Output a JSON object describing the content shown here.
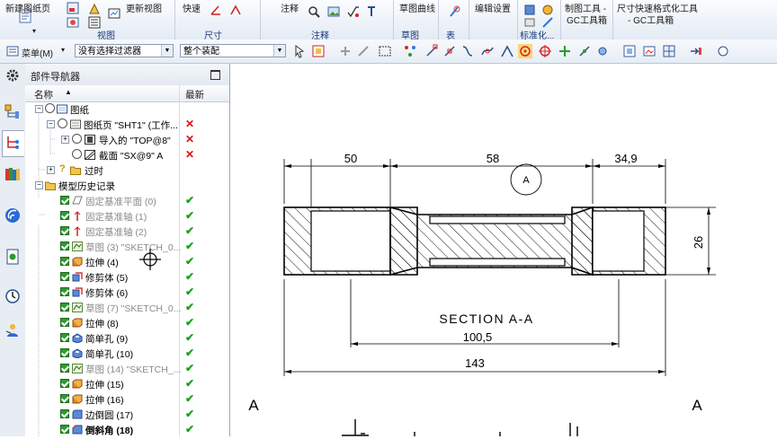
{
  "ribbon": {
    "new_sheet": "新建图纸页",
    "update_view": "更新视图",
    "view_group": "视图",
    "quick": "快速",
    "dimension_group": "尺寸",
    "annotation": "注释",
    "annotation_group": "注释",
    "sketch_curve": "草图曲线",
    "sketch_group": "草图",
    "table_group": "表",
    "edit_settings": "编辑设置",
    "standardize": "标准化...",
    "drafting_tool": "制图工具 -",
    "drafting_tool2": "GC工具箱",
    "dim_format": "尺寸快速格式化工具",
    "dim_format2": "- GC工具箱"
  },
  "toolbar": {
    "menu_label": "菜单(M)",
    "filter_value": "没有选择过滤器",
    "assembly_value": "整个装配"
  },
  "navigator": {
    "title": "部件导航器",
    "col_name": "名称",
    "col_latest": "最新",
    "rows": [
      {
        "label": "图纸",
        "status": ""
      },
      {
        "label": "图纸页 \"SHT1\" (工作...",
        "status": "✕"
      },
      {
        "label": "导入的 \"TOP@8\"",
        "status": "✕"
      },
      {
        "label": "截面 \"SX@9\" A",
        "status": "✕"
      },
      {
        "label": "过时",
        "status": ""
      },
      {
        "label": "模型历史记录",
        "status": ""
      },
      {
        "label": "固定基准平面 (0)",
        "status": "✔"
      },
      {
        "label": "固定基准轴 (1)",
        "status": "✔"
      },
      {
        "label": "固定基准轴 (2)",
        "status": "✔"
      },
      {
        "label": "草图 (3) \"SKETCH_0...",
        "status": "✔"
      },
      {
        "label": "拉伸 (4)",
        "status": "✔"
      },
      {
        "label": "修剪体 (5)",
        "status": "✔"
      },
      {
        "label": "修剪体 (6)",
        "status": "✔"
      },
      {
        "label": "草图 (7) \"SKETCH_0...",
        "status": "✔"
      },
      {
        "label": "拉伸 (8)",
        "status": "✔"
      },
      {
        "label": "简单孔 (9)",
        "status": "✔"
      },
      {
        "label": "简单孔 (10)",
        "status": "✔"
      },
      {
        "label": "草图 (14) \"SKETCH_...",
        "status": "✔"
      },
      {
        "label": "拉伸 (15)",
        "status": "✔"
      },
      {
        "label": "拉伸 (16)",
        "status": "✔"
      },
      {
        "label": "边倒圆 (17)",
        "status": "✔"
      },
      {
        "label": "倒斜角 (18)",
        "status": "✔"
      }
    ]
  },
  "drawing": {
    "dim_50": "50",
    "dim_58": "58",
    "dim_34_9": "34,9",
    "balloon": "A",
    "dim_26": "26",
    "section_label": "SECTION A-A",
    "dim_100_5": "100,5",
    "dim_143": "143",
    "cut_left": "A",
    "cut_right": "A"
  }
}
